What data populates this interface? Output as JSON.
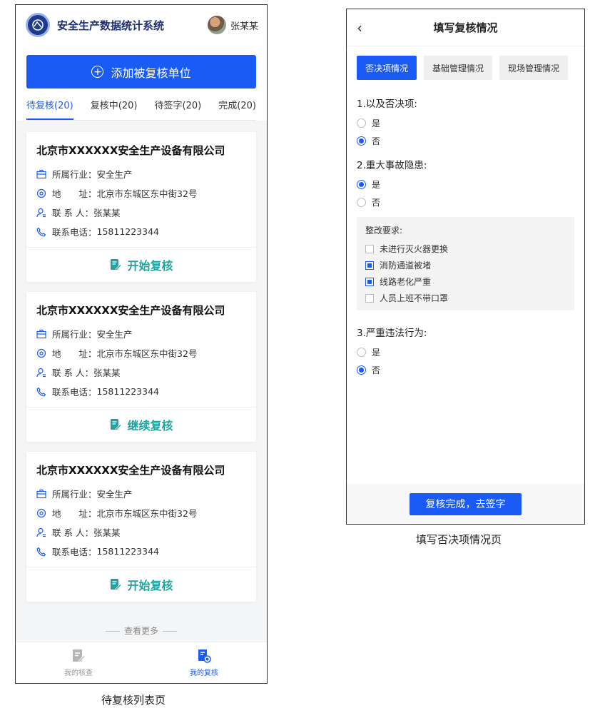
{
  "left": {
    "app_title": "安全生产数据统计系统",
    "user_name": "张某某",
    "add_button": "添加被复核单位",
    "tabs": [
      {
        "label": "待复核(20)",
        "active": true
      },
      {
        "label": "复核中(20)",
        "active": false
      },
      {
        "label": "待签字(20)",
        "active": false
      },
      {
        "label": "完成(20)",
        "active": false
      }
    ],
    "cards": [
      {
        "company": "北京市XXXXXX安全生产设备有限公司",
        "industry_label": "所属行业：",
        "industry": "安全生产",
        "address_label": "地　　址：",
        "address": "北京市东城区东中街32号",
        "contact_label": "联 系 人：",
        "contact": "张某某",
        "phone_label": "联系电话：",
        "phone": "15811223344",
        "action": "开始复核"
      },
      {
        "company": "北京市XXXXXX安全生产设备有限公司",
        "industry_label": "所属行业：",
        "industry": "安全生产",
        "address_label": "地　　址：",
        "address": "北京市东城区东中街32号",
        "contact_label": "联 系 人：",
        "contact": "张某某",
        "phone_label": "联系电话：",
        "phone": "15811223344",
        "action": "继续复核"
      },
      {
        "company": "北京市XXXXXX安全生产设备有限公司",
        "industry_label": "所属行业：",
        "industry": "安全生产",
        "address_label": "地　　址：",
        "address": "北京市东城区东中街32号",
        "contact_label": "联 系 人：",
        "contact": "张某某",
        "phone_label": "联系电话：",
        "phone": "15811223344",
        "action": "开始复核"
      }
    ],
    "more": "查看更多",
    "nav": [
      {
        "label": "我的核查",
        "icon": "edit-doc-icon",
        "active": false
      },
      {
        "label": "我的复核",
        "icon": "review-doc-icon",
        "active": true
      }
    ],
    "caption": "待复核列表页"
  },
  "right": {
    "title": "填写复核情况",
    "tabs": [
      {
        "label": "否决项情况",
        "active": true
      },
      {
        "label": "基础管理情况",
        "active": false
      },
      {
        "label": "现场管理情况",
        "active": false
      }
    ],
    "q1": {
      "title": "1.以及否决项:",
      "opt_yes": "是",
      "opt_no": "否",
      "selected": "否"
    },
    "q2": {
      "title": "2.重大事故隐患:",
      "opt_yes": "是",
      "opt_no": "否",
      "selected": "是",
      "rect_title": "整改要求:",
      "items": [
        {
          "label": "未进行灭火器更换",
          "checked": false
        },
        {
          "label": "消防通道被堵",
          "checked": true
        },
        {
          "label": "线路老化严重",
          "checked": true
        },
        {
          "label": "人员上班不带口罩",
          "checked": false
        }
      ]
    },
    "q3": {
      "title": "3.严重违法行为:",
      "opt_yes": "是",
      "opt_no": "否",
      "selected": "否"
    },
    "submit": "复核完成，去签字",
    "caption": "填写否决项情况页"
  },
  "colors": {
    "primary": "#1a5bf5",
    "action_teal": "#20a3a0",
    "header_navy": "#1d2f73"
  }
}
